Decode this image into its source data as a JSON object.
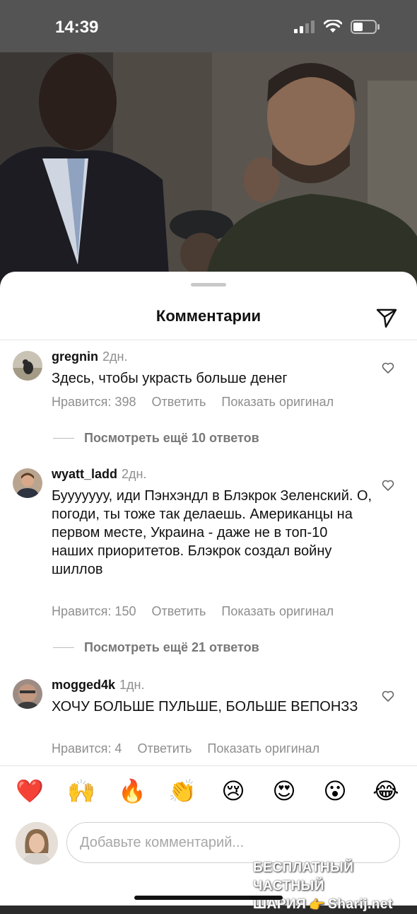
{
  "status_bar": {
    "time": "14:39"
  },
  "sheet": {
    "title": "Комментарии"
  },
  "comments": [
    {
      "username": "gregnin",
      "time": "2дн.",
      "text": "Здесь, чтобы украсть больше денег",
      "likes": "Нравится: 398",
      "reply": "Ответить",
      "show_original": "Показать оригинал",
      "more_replies": "Посмотреть ещё 10 ответов"
    },
    {
      "username": "wyatt_ladd",
      "time": "2дн.",
      "text": "Бууууууу, иди Пэнхэндл в Блэкрок Зеленский. О, погоди, ты тоже так делаешь. Американцы на первом месте, Украина - даже не в топ-10 наших приоритетов. Блэкрок создал войну шиллов",
      "likes": "Нравится: 150",
      "reply": "Ответить",
      "show_original": "Показать оригинал",
      "more_replies": "Посмотреть ещё 21 ответов"
    },
    {
      "username": "mogged4k",
      "time": "1дн.",
      "text": "ХОЧУ БОЛЬШЕ ПУЛЬШЕ, БОЛЬШЕ ВЕПОНЗЗ",
      "likes": "Нравится: 4",
      "reply": "Ответить",
      "show_original": "Показать оригинал"
    }
  ],
  "emojis": [
    "❤️",
    "🙌",
    "🔥",
    "👏",
    "😢",
    "😍",
    "😮",
    "😂"
  ],
  "compose": {
    "placeholder": "Добавьте комментарий..."
  },
  "watermark": {
    "line1": "БЕСПЛАТНЫЙ ЧАСТНЫЙ",
    "line2a": "ШАРИЯ",
    "line2b": "Sharij.net"
  }
}
